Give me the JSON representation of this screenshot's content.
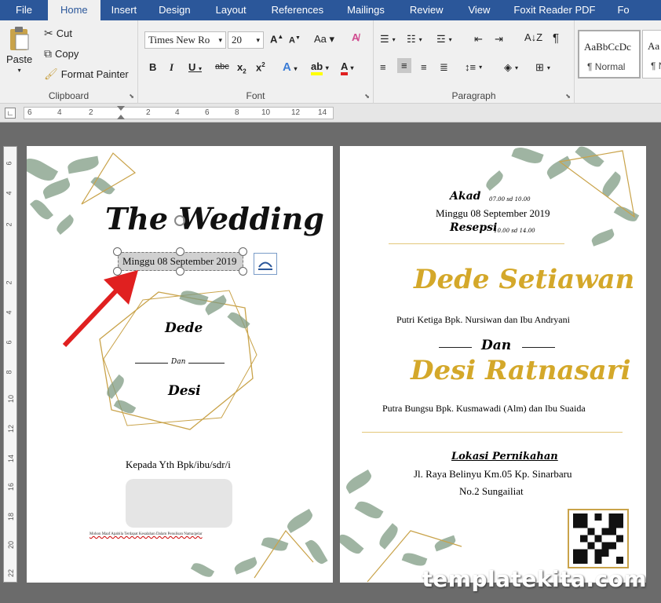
{
  "tabs": [
    "File",
    "Home",
    "Insert",
    "Design",
    "Layout",
    "References",
    "Mailings",
    "Review",
    "View",
    "Foxit Reader PDF",
    "Fo"
  ],
  "clipboard": {
    "paste": "Paste",
    "cut": "Cut",
    "copy": "Copy",
    "format_painter": "Format Painter",
    "label": "Clipboard"
  },
  "font": {
    "name": "Times New Ro",
    "size": "20",
    "label": "Font"
  },
  "paragraph": {
    "label": "Paragraph"
  },
  "styles": [
    {
      "sample": "AaBbCcDc",
      "name": "¶ Normal"
    },
    {
      "sample": "Aa",
      "name": "¶ N"
    }
  ],
  "ruler_h": [
    "6",
    "4",
    "2",
    "2",
    "4",
    "6",
    "8",
    "10",
    "12",
    "14"
  ],
  "ruler_v": [
    "6",
    "4",
    "2",
    "2",
    "4",
    "6",
    "8",
    "10",
    "12",
    "14",
    "16",
    "18",
    "20",
    "22"
  ],
  "page1": {
    "title": "The Wedding",
    "date": "Minggu 08 September 2019",
    "groom": "Dede",
    "dan": "Dan",
    "bride": "Desi",
    "kepada": "Kepada Yth Bpk/ibu/sdr/i",
    "footnote": "Mohon Maaf Apabila Terdapat Kesalahan Dalam Penulisan Nama/gelar"
  },
  "page2": {
    "akad_label": "Akad",
    "akad_time": "07.00 sd 10.00",
    "date": "Minggu 08 September 2019",
    "resepsi_label": "Resepsi",
    "resepsi_time": "10.00 sd 14.00",
    "groom": "Dede Setiawan",
    "groom_parents": "Putri Ketiga Bpk. Nursiwan dan Ibu Andryani",
    "dan": "Dan",
    "bride": "Desi Ratnasari",
    "bride_parents": "Putra Bungsu Bpk. Kusmawadi (Alm) dan Ibu Suaida",
    "lokasi_label": "Lokasi Pernikahan",
    "address1": "Jl. Raya Belinyu Km.05 Kp. Sinarbaru",
    "address2": "No.2 Sungailiat"
  },
  "watermark": "templatekita.com",
  "colors": {
    "ribbon_blue": "#2b579a",
    "gold": "#d4a82a",
    "arrow_red": "#e02020",
    "leaf_green": "#7f9b83"
  }
}
